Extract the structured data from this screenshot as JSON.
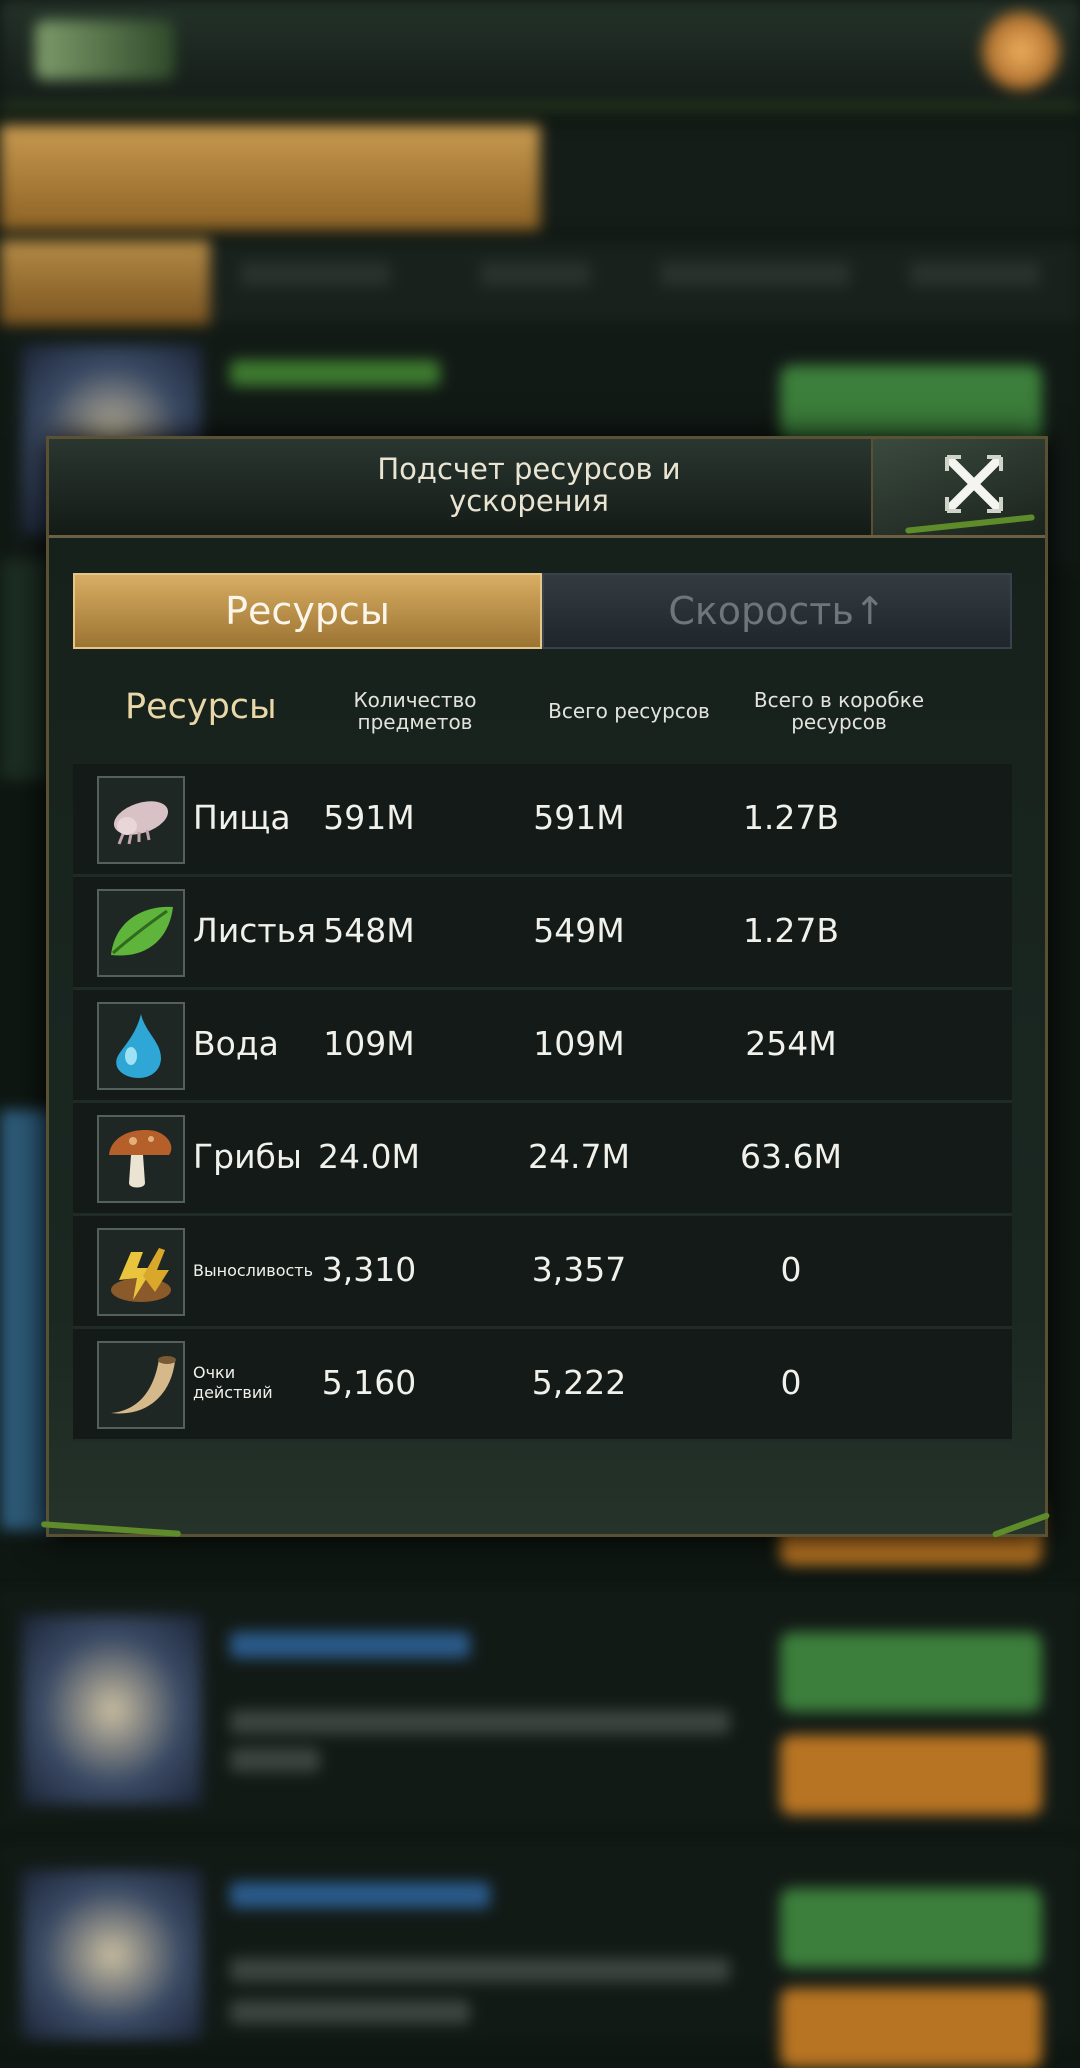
{
  "dialog": {
    "title_line1": "Подсчет ресурсов и",
    "title_line2": "ускорения",
    "tabs": {
      "resources": "Ресурсы",
      "speed": "Скорость↑"
    },
    "columns": {
      "resource": "Ресурсы",
      "item_count_line1": "Количество",
      "item_count_line2": "предметов",
      "total_resources": "Всего ресурсов",
      "box_total_line1": "Всего в коробке",
      "box_total_line2": "ресурсов"
    },
    "rows": [
      {
        "name": "Пища",
        "icon": "food-icon",
        "count": "591M",
        "total": "591M",
        "box": "1.27B"
      },
      {
        "name": "Листья",
        "icon": "leaf-icon",
        "count": "548M",
        "total": "549M",
        "box": "1.27B"
      },
      {
        "name": "Вода",
        "icon": "water-drop-icon",
        "count": "109M",
        "total": "109M",
        "box": "254M"
      },
      {
        "name": "Грибы",
        "icon": "mushroom-icon",
        "count": "24.0M",
        "total": "24.7M",
        "box": "63.6M"
      },
      {
        "name": "Выносливость",
        "icon": "stamina-icon",
        "count": "3,310",
        "total": "3,357",
        "box": "0"
      },
      {
        "name_line1": "Очки",
        "name_line2": "действий",
        "icon": "horn-icon",
        "count": "5,160",
        "total": "5,222",
        "box": "0"
      }
    ]
  },
  "colors": {
    "active_tab": "#c49a52",
    "inactive_tab": "#2a3137",
    "dialog_bg": "#1a2520",
    "vine_green": "#5f8c2a"
  }
}
